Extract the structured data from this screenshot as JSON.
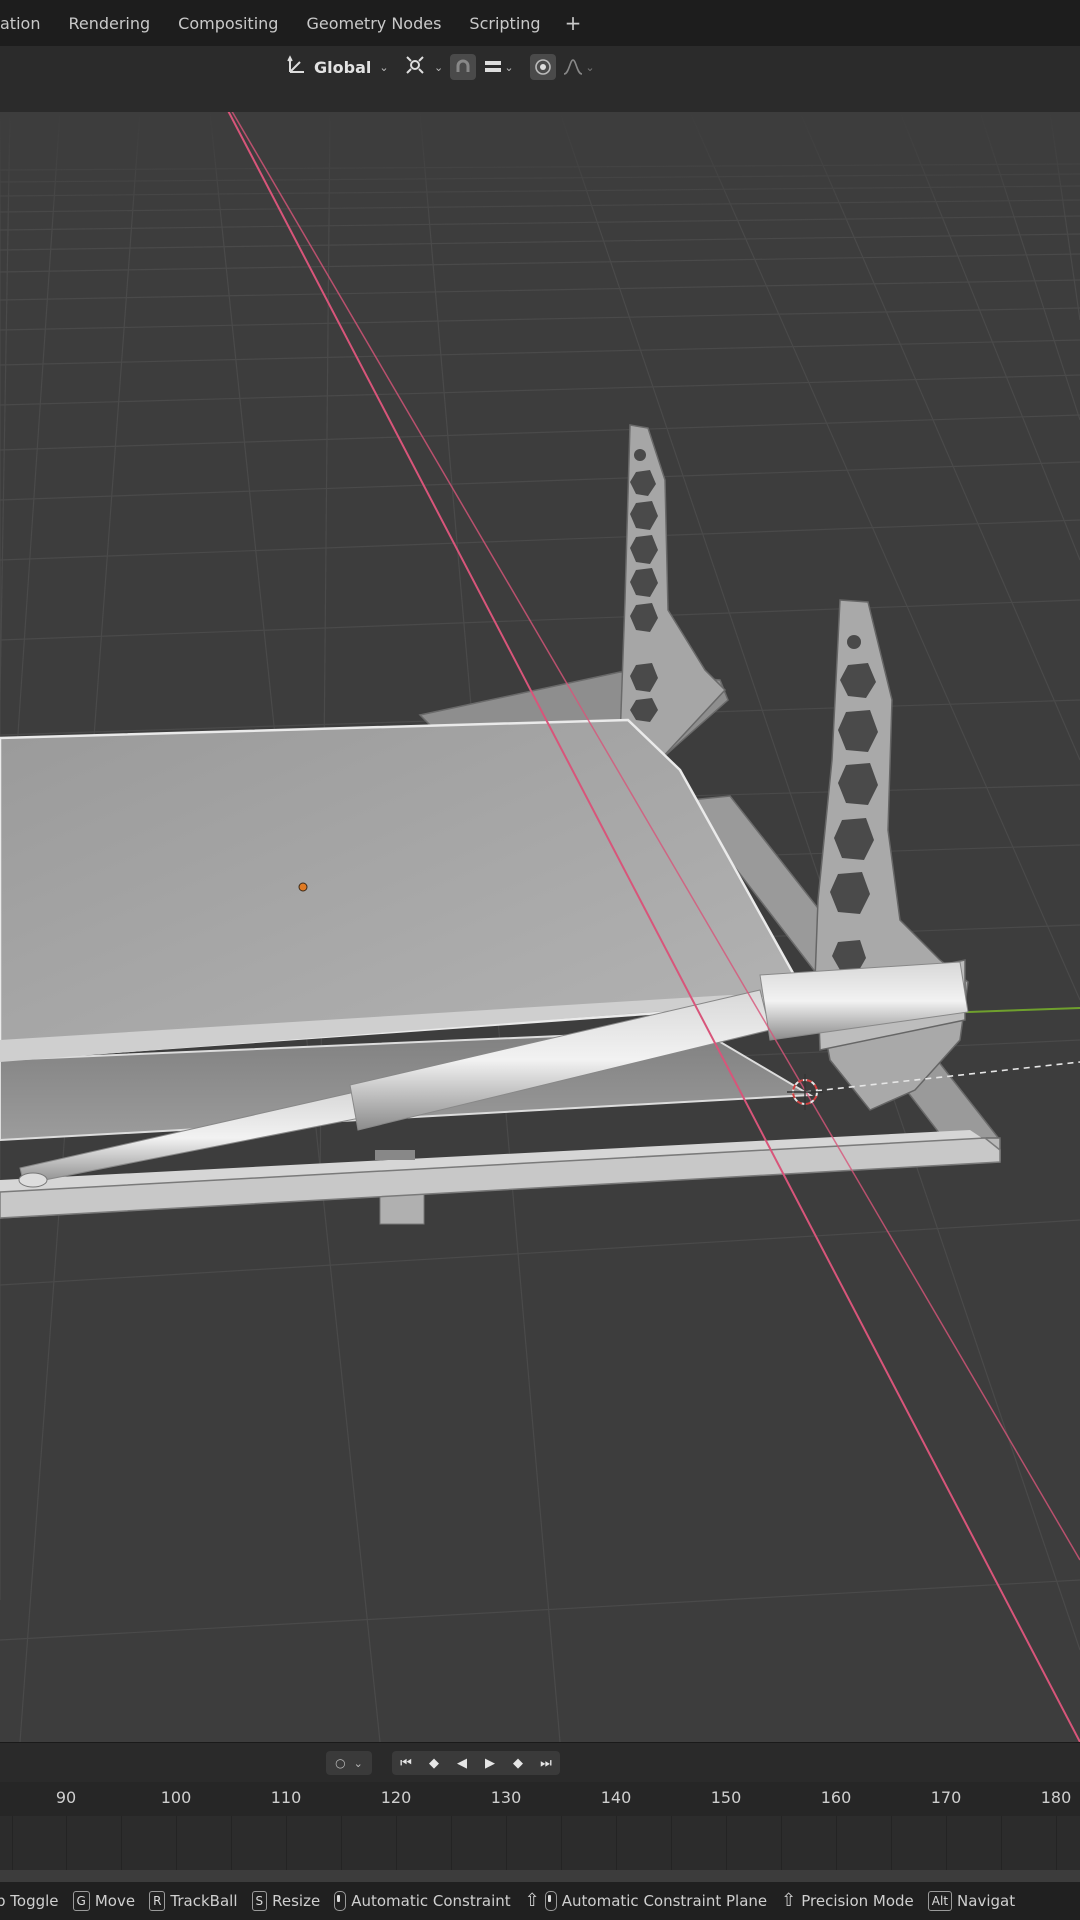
{
  "workspace_tabs": [
    "ation",
    "Rendering",
    "Compositing",
    "Geometry Nodes",
    "Scripting"
  ],
  "workspace_add": "+",
  "header": {
    "orientation_label": "Global"
  },
  "timeline": {
    "frame_ticks": [
      "90",
      "100",
      "110",
      "120",
      "130",
      "140",
      "150",
      "160",
      "170",
      "180"
    ]
  },
  "statusbar": {
    "items": [
      {
        "key": "",
        "label": "p Toggle"
      },
      {
        "key": "G",
        "label": "Move"
      },
      {
        "key": "R",
        "label": "TrackBall"
      },
      {
        "key": "S",
        "label": "Resize"
      },
      {
        "key": "mouse",
        "label": "Automatic Constraint"
      },
      {
        "key": "shift+mouse",
        "label": "Automatic Constraint Plane"
      },
      {
        "key": "shift",
        "label": "Precision Mode"
      },
      {
        "key": "Alt",
        "label": "Navigat"
      }
    ]
  },
  "colors": {
    "x_axis": "#d8557a",
    "y_axis": "#6fa02d",
    "viewport_bg": "#3d3d3d",
    "mesh": "#a8a8a8",
    "origin": "#e07a22"
  }
}
